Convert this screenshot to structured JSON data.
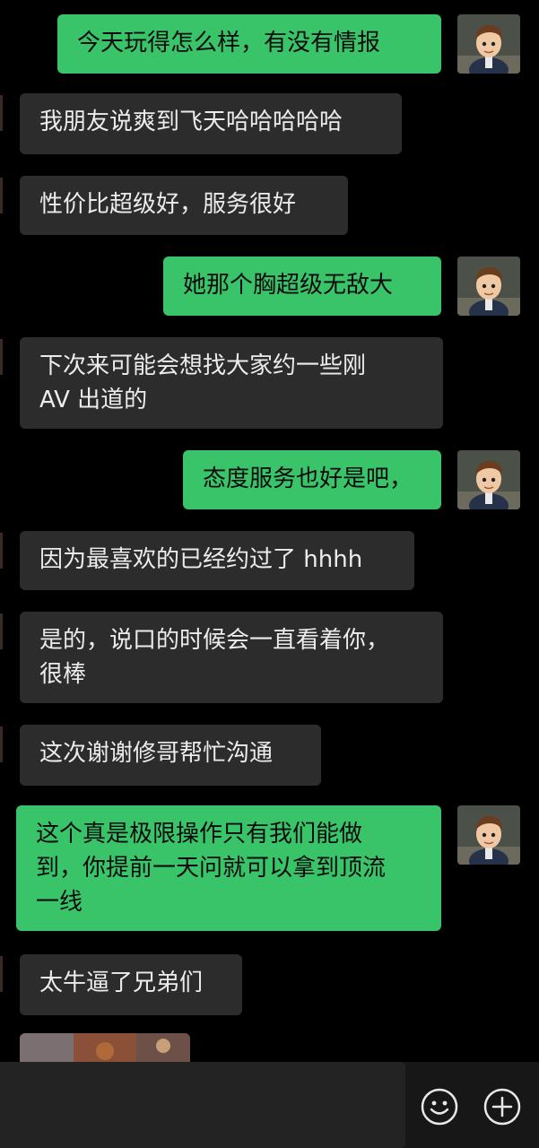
{
  "messages": [
    {
      "side": "out",
      "text": "今天玩得怎么样，有没有情报"
    },
    {
      "side": "in",
      "text": "我朋友说爽到飞天哈哈哈哈哈"
    },
    {
      "side": "in",
      "text": "性价比超级好，服务很好"
    },
    {
      "side": "out",
      "text": "她那个胸超级无敌大"
    },
    {
      "side": "in",
      "text": "下次来可能会想找大家约一些刚\nAV 出道的"
    },
    {
      "side": "out",
      "text": "态度服务也好是吧，"
    },
    {
      "side": "in",
      "text": "因为最喜欢的已经约过了 hhhh"
    },
    {
      "side": "in",
      "text": "是的，说口的时候会一直看着你，\n很棒"
    },
    {
      "side": "in",
      "text": "这次谢谢修哥帮忙沟通"
    },
    {
      "side": "out",
      "text": "这个真是极限操作只有我们能做\n到，你提前一天问就可以拿到顶流\n一线"
    },
    {
      "side": "in",
      "text": "太牛逼了兄弟们"
    }
  ],
  "input_bar": {
    "emoji_icon": "smiley-face-icon",
    "more_icon": "plus-circle-icon"
  },
  "colors": {
    "background": "#000000",
    "outgoing_bubble": "#3ac46a",
    "incoming_bubble": "#2c2c2c",
    "input_bar": "#171717"
  }
}
